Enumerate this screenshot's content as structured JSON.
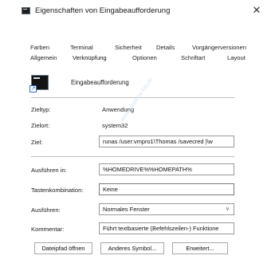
{
  "window": {
    "title": "Eigenschaften von Eingabeaufforderung",
    "close_glyph": "✕",
    "title_icon": "console-icon"
  },
  "tabs_row1": [
    "Farben",
    "Terminal",
    "Sicherheit",
    "Details",
    "Vorgängerversionen"
  ],
  "tabs_row2": [
    "Allgemein",
    "Verknüpfung",
    "Optionen",
    "Schriftart",
    "Layout"
  ],
  "active_tab": "Verknüpfung",
  "app": {
    "name": "Eingabeaufforderung",
    "icon": "command-prompt-icon"
  },
  "fields": {
    "zieltyp_label": "Zieltyp:",
    "zieltyp_value": "Anwendung",
    "zielort_label": "Zielort:",
    "zielort_value": "system32",
    "ziel_label": "Ziel:",
    "ziel_value": "runas /user:vmpro1\\Thomas /savecred |\\w",
    "ausfuehren_in_label": "Ausführen in:",
    "ausfuehren_in_value": "%HOMEDRIVE%%HOMEPATH%",
    "tasten_label": "Tastenkombination:",
    "tasten_value": "Keine",
    "ausfuehren_label": "Ausführen:",
    "ausfuehren_value": "Normales Fenster",
    "kommentar_label": "Kommentar:",
    "kommentar_value": "Führt textbasierte (Befehlszeilen-) Funktione"
  },
  "buttons": {
    "dateipfad": "Dateipfad öffnen",
    "symbol": "Anderes Symbol...",
    "erweitert": "Erweitert..."
  },
  "watermark": "www.windows-faq.de"
}
